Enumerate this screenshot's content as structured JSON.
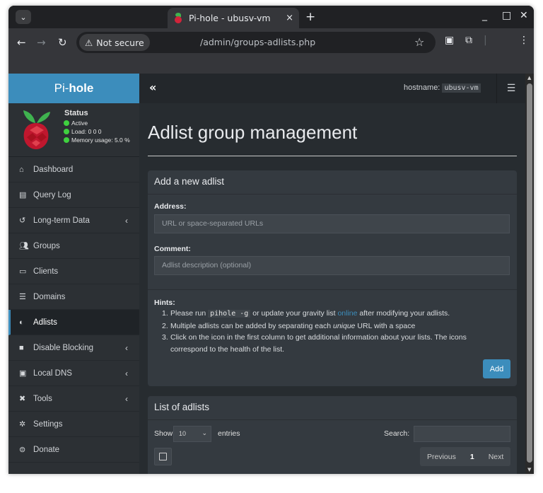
{
  "browser": {
    "tab_title": "Pi-hole - ubusv-vm",
    "tab_close": "×",
    "new_tab": "+",
    "security_label": "Not secure",
    "url": "/admin/groups-adlists.php"
  },
  "sidebar": {
    "brand_prefix": "Pi-",
    "brand_suffix": "hole",
    "status": {
      "title": "Status",
      "active": "Active",
      "load": "Load:  0  0  0",
      "memory": "Memory usage:  5.0 %"
    },
    "items": [
      {
        "label": "Dashboard",
        "icon": "home-icon"
      },
      {
        "label": "Query Log",
        "icon": "file-icon"
      },
      {
        "label": "Long-term Data",
        "icon": "history-icon"
      },
      {
        "label": "Groups",
        "icon": "users-icon"
      },
      {
        "label": "Clients",
        "icon": "laptop-icon"
      },
      {
        "label": "Domains",
        "icon": "list-icon"
      },
      {
        "label": "Adlists",
        "icon": "shield-icon"
      },
      {
        "label": "Disable Blocking",
        "icon": "stop-icon"
      },
      {
        "label": "Local DNS",
        "icon": "address-book-icon"
      },
      {
        "label": "Tools",
        "icon": "tools-icon"
      },
      {
        "label": "Settings",
        "icon": "gear-icon"
      },
      {
        "label": "Donate",
        "icon": "donate-icon"
      }
    ]
  },
  "header": {
    "collapse": "«",
    "hostname_label": "hostname:",
    "hostname_value": "ubusv-vm"
  },
  "main": {
    "title": "Adlist group management",
    "add_card": {
      "header": "Add a new adlist",
      "address_label": "Address:",
      "address_placeholder": "URL or space-separated URLs",
      "comment_label": "Comment:",
      "comment_placeholder": "Adlist description (optional)",
      "hints_title": "Hints:",
      "hint1_num": "1.",
      "hint1_a": "Please run ",
      "hint1_code": "pihole -g",
      "hint1_b": " or update your gravity list ",
      "hint1_link": "online",
      "hint1_c": " after modifying your adlists.",
      "hint2_num": "2.",
      "hint2_a": "Multiple adlists can be added by separating each ",
      "hint2_em": "unique",
      "hint2_b": " URL with a space",
      "hint3_num": "3.",
      "hint3_line1": "Click on the icon in the first column to get additional information about your lists. The icons",
      "hint3_line2": "correspond to the health of the list.",
      "add_button": "Add"
    },
    "list_card": {
      "header": "List of adlists",
      "show_label": "Show",
      "entries_value": "10",
      "entries_label": "entries",
      "search_label": "Search:",
      "prev_label": "Previous",
      "page_number": "1",
      "next_label": "Next"
    }
  },
  "colors": {
    "accent": "#3c8dbc",
    "status_green": "#3fd13f",
    "sidebar_bg": "#2c3034",
    "content_bg": "#272c30"
  }
}
